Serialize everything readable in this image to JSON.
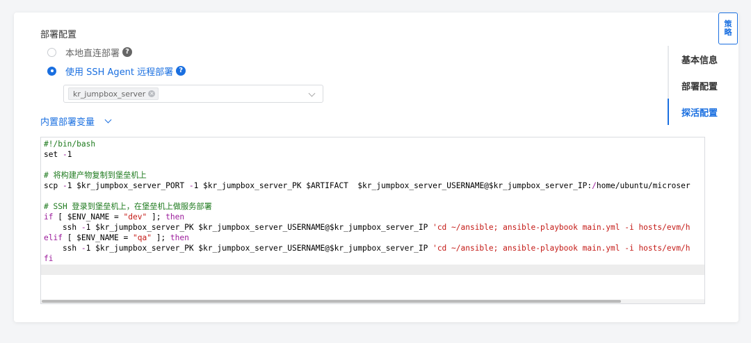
{
  "strategy_tab": "策\n略",
  "deploy": {
    "section_title": "部署配置",
    "options": [
      {
        "label": "本地直连部署",
        "checked": false
      },
      {
        "label": "使用 SSH Agent 远程部署",
        "checked": true
      }
    ],
    "help_glyph": "?",
    "selected_tag": "kr_jumpbox_server",
    "tag_close": "×",
    "vars_toggle": "内置部署变量"
  },
  "anchors": [
    {
      "label": "基本信息",
      "active": false
    },
    {
      "label": "部署配置",
      "active": false
    },
    {
      "label": "探活配置",
      "active": true
    }
  ],
  "code_lines": [
    "#!/bin/bash",
    "set -ex",
    "",
    "# 将构建产物复制到堡垒机上",
    "scp -P $kr_jumpbox_server_PORT -i $kr_jumpbox_server_PK $ARTIFACT  $kr_jumpbox_server_USERNAME@$kr_jumpbox_server_IP:/home/ubuntu/microser",
    "",
    "# SSH 登录到堡垒机上，在堡垒机上做服务部署",
    "if [ $ENV_NAME = \"dev\" ]; then",
    "    ssh -i $kr_jumpbox_server_PK $kr_jumpbox_server_USERNAME@$kr_jumpbox_server_IP 'cd ~/ansible; ansible-playbook main.yml -i hosts/evm/h",
    "elif [ $ENV_NAME = \"qa\" ]; then",
    "    ssh -i $kr_jumpbox_server_PK $kr_jumpbox_server_USERNAME@$kr_jumpbox_server_IP 'cd ~/ansible; ansible-playbook main.yml -i hosts/evm/h",
    "fi"
  ],
  "colors": {
    "accent": "#1a6fe0",
    "comment": "#1e7a1e",
    "keyword": "#9b1b9b",
    "string": "#c41a16"
  }
}
